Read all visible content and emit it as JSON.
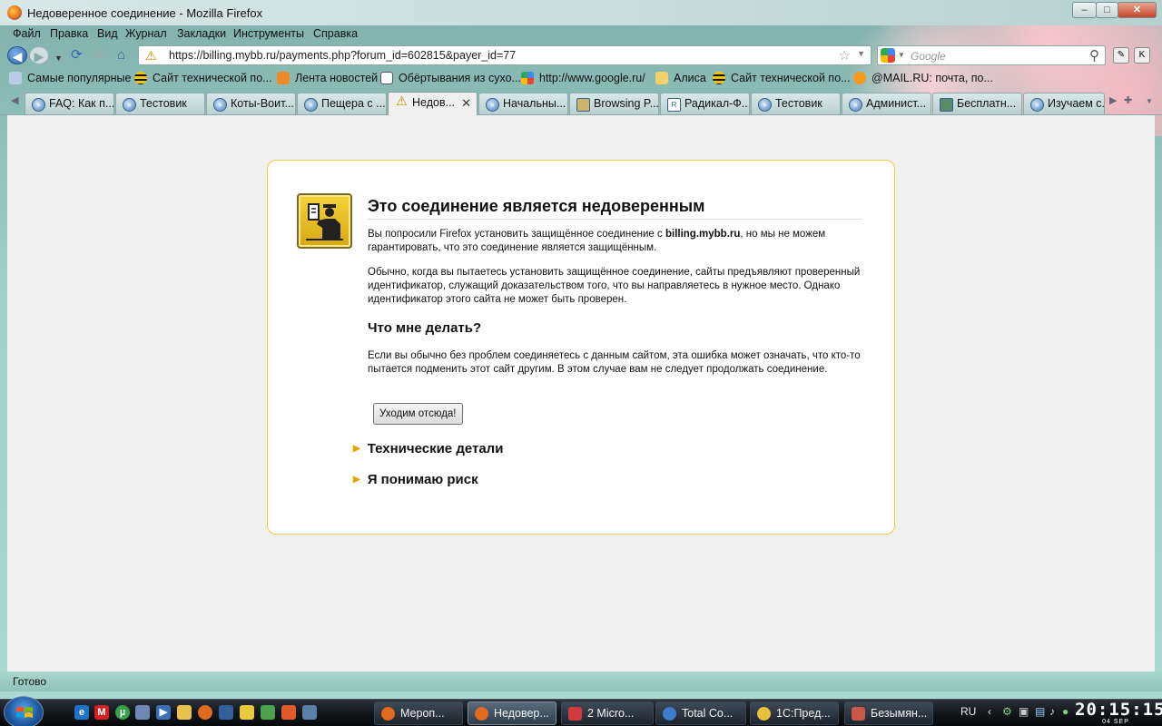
{
  "window": {
    "title": "Недоверенное соединение - Mozilla Firefox",
    "controls": {
      "minimize": "–",
      "maximize": "□",
      "close": "✕"
    }
  },
  "menu": [
    "Файл",
    "Правка",
    "Вид",
    "Журнал",
    "Закладки",
    "Инструменты",
    "Справка"
  ],
  "nav": {
    "url": "https://billing.mybb.ru/payments.php?forum_id=602815&payer_id=77",
    "search_placeholder": "Google"
  },
  "bookmarks": [
    "Самые популярные",
    "Сайт технической по...",
    "Лента новостей",
    "Обёртывания из сухо...",
    "http://www.google.ru/",
    "Алиса",
    "Сайт технической по...",
    "@MAIL.RU: почта, по..."
  ],
  "tabs": [
    "FAQ: Как п...",
    "Тестовик",
    "Коты-Воит...",
    "Пещера с ...",
    "Недов...",
    "Начальны...",
    "Browsing P...",
    "Радикал-Ф...",
    "Тестовик",
    "Админист...",
    "Бесплатн...",
    "Изучаем с..."
  ],
  "error": {
    "title": "Это соединение является недоверенным",
    "p1_before": "Вы попросили Firefox установить защищённое соединение с ",
    "p1_host": "billing.mybb.ru",
    "p1_after": ", но мы не можем гарантировать, что это соединение является защищённым.",
    "p2": "Обычно, когда вы пытаетесь установить защищённое соединение, сайты предъявляют проверенный идентификатор, служащий доказательством того, что вы направляетесь в нужное место. Однако идентификатор этого сайта не может быть проверен.",
    "what_to_do": "Что мне делать?",
    "p3": "Если вы обычно без проблем соединяетесь с данным сайтом, эта ошибка может означать, что кто-то пытается подменить этот сайт другим. В этом случае вам не следует продолжать соединение.",
    "get_me_out": "Уходим отсюда!",
    "technical_details": "Технические детали",
    "understand_risks": "Я понимаю риск"
  },
  "status": "Готово",
  "taskbar": {
    "buttons": [
      "Мероп...",
      "Недовер...",
      "2 Micro...",
      "Total Co...",
      "1С:Пред...",
      "Безымян..."
    ],
    "lang": "RU",
    "time": "20:15:15",
    "date": "04 SEP"
  }
}
